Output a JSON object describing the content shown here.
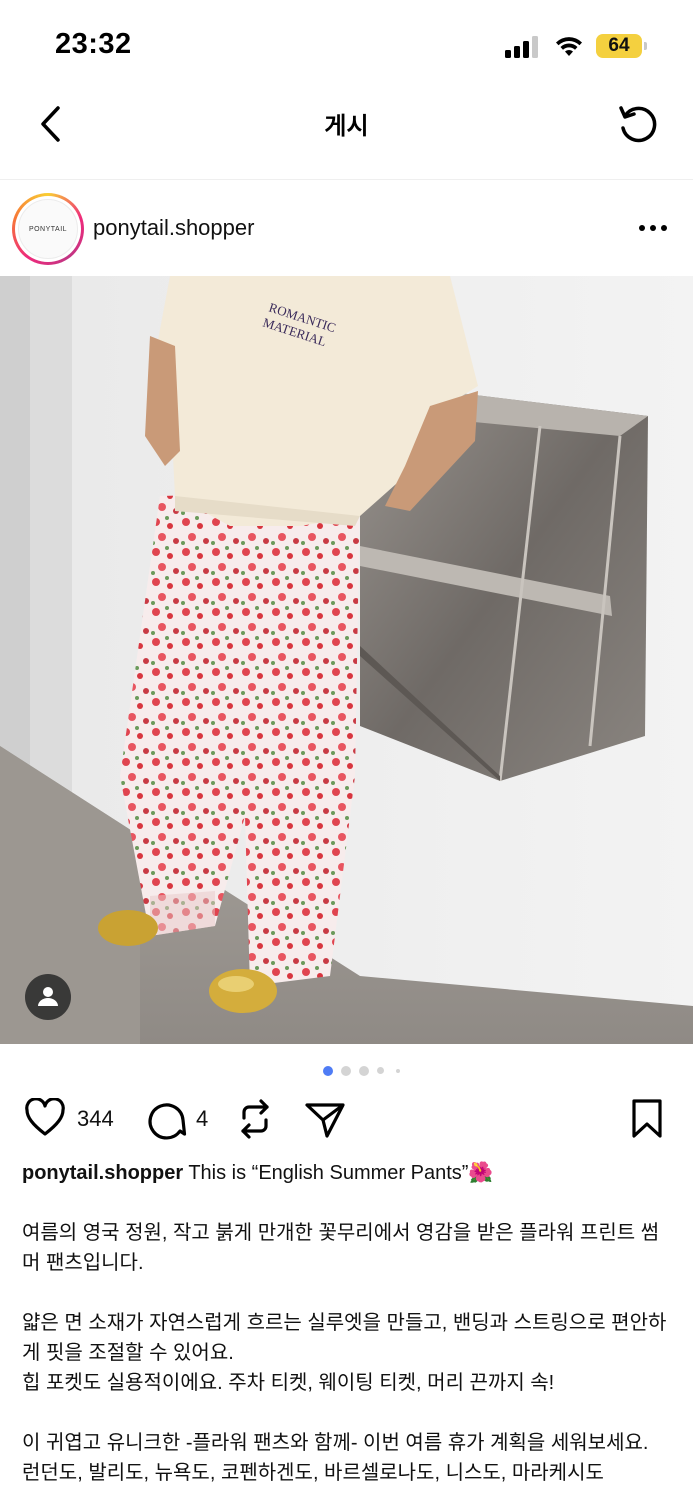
{
  "status_bar": {
    "time": "23:32",
    "battery_level": "64",
    "battery_color": "#f4d03f"
  },
  "nav": {
    "title": "게시",
    "back_icon": "chevron-left-icon",
    "refresh_icon": "refresh-icon"
  },
  "post": {
    "avatar_text": "PONYTAIL",
    "username": "ponytail.shopper",
    "more_icon": "more-horizontal-icon",
    "carousel": {
      "total": 5,
      "active_index": 0
    },
    "likes": "344",
    "comments": "4",
    "caption_user": "ponytail.shopper",
    "caption_title": "This is “English Summer Pants”🌺",
    "caption_lines": [
      "여름의 영국 정원, 작고 붉게 만개한 꽃무리에서 영감을 받은 플라워 프린트 썸머 팬츠입니다.",
      "얇은 면 소재가 자연스럽게 흐르는 실루엣을 만들고, 밴딩과 스트링으로 편안하게 핏을 조절할 수 있어요.",
      "힙 포켓도 실용적이에요. 주차 티켓, 웨이팅 티켓, 머리 끈까지 속!",
      "이 귀엽고 유니크한 -플라워 팬츠와 함께- 이번 여름 휴가 계획을 세워보세요.",
      "런던도, 발리도, 뉴욕도, 코펜하겐도, 바르셀로나도, 니스도, 마라케시도"
    ],
    "image_shirt_text": [
      "ROMANTIC",
      "MATERIAL"
    ]
  },
  "colors": {
    "active_dot": "#3897f0",
    "inactive_dot": "#d4d4d4"
  }
}
